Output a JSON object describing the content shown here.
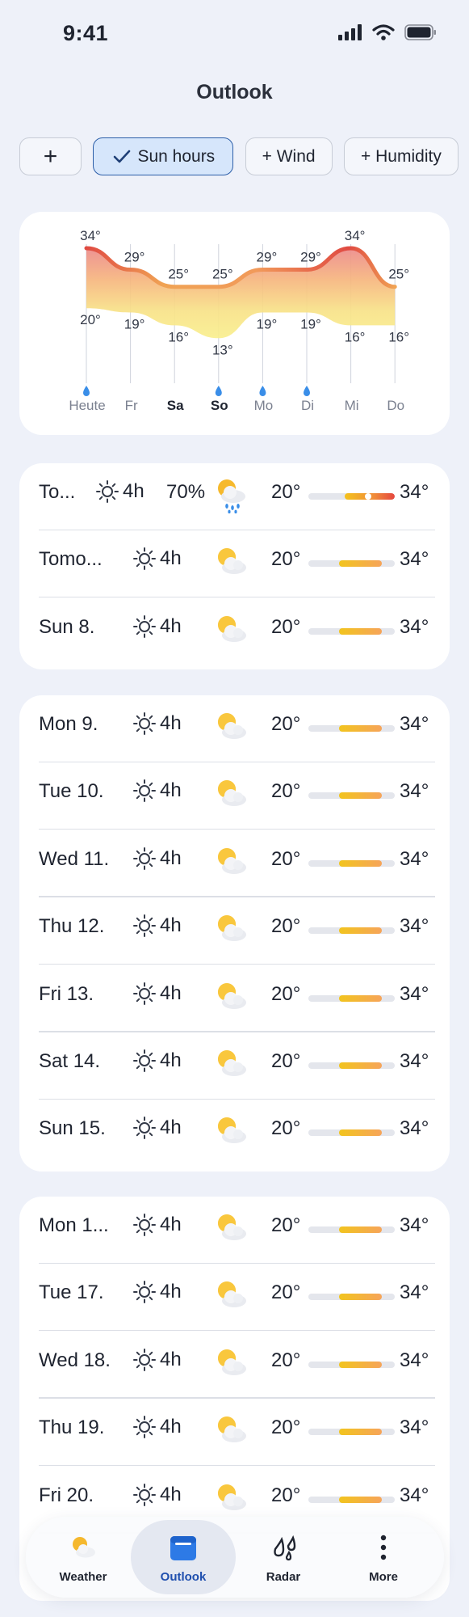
{
  "status_bar": {
    "time": "9:41"
  },
  "header": {
    "title": "Outlook"
  },
  "chips": [
    {
      "label": "+",
      "active": false
    },
    {
      "label": "Sun hours",
      "active": true
    },
    {
      "label": "+ Wind",
      "active": false
    },
    {
      "label": "+ Humidity",
      "active": false
    }
  ],
  "chart_data": {
    "type": "area",
    "categories": [
      "Heute",
      "Fr",
      "Sa",
      "So",
      "Mo",
      "Di",
      "Mi",
      "Do"
    ],
    "highlighted_categories": [
      "Sa",
      "So"
    ],
    "rain_days": [
      "Heute",
      "So",
      "Mo",
      "Di"
    ],
    "series": [
      {
        "name": "max",
        "values": [
          34,
          29,
          25,
          25,
          29,
          29,
          34,
          25
        ]
      },
      {
        "name": "min",
        "values": [
          20,
          19,
          16,
          13,
          19,
          19,
          16,
          16
        ]
      }
    ],
    "unit": "°",
    "colors": {
      "hot": "#e04a42",
      "warm": "#f0a354",
      "cool": "#f6e87a"
    }
  },
  "forecast_groups": [
    [
      {
        "day": "To...",
        "sun": "4h",
        "precip": "70%",
        "icon": "sun-cloud-rain",
        "min": "20°",
        "max": "34°",
        "current": true
      },
      {
        "day": "Tomo...",
        "sun": "4h",
        "icon": "partly-cloudy",
        "min": "20°",
        "max": "34°"
      },
      {
        "day": "Sun 8.",
        "sun": "4h",
        "icon": "partly-cloudy",
        "min": "20°",
        "max": "34°"
      }
    ],
    [
      {
        "day": "Mon 9.",
        "sun": "4h",
        "icon": "partly-cloudy",
        "min": "20°",
        "max": "34°"
      },
      {
        "day": "Tue 10.",
        "sun": "4h",
        "icon": "partly-cloudy",
        "min": "20°",
        "max": "34°"
      },
      {
        "day": "Wed 11.",
        "sun": "4h",
        "icon": "partly-cloudy",
        "min": "20°",
        "max": "34°"
      },
      {
        "day": "Thu 12.",
        "sun": "4h",
        "icon": "partly-cloudy",
        "min": "20°",
        "max": "34°"
      },
      {
        "day": "Fri 13.",
        "sun": "4h",
        "icon": "partly-cloudy",
        "min": "20°",
        "max": "34°"
      },
      {
        "day": "Sat 14.",
        "sun": "4h",
        "icon": "partly-cloudy",
        "min": "20°",
        "max": "34°"
      },
      {
        "day": "Sun 15.",
        "sun": "4h",
        "icon": "partly-cloudy",
        "min": "20°",
        "max": "34°"
      }
    ],
    [
      {
        "day": "Mon 1...",
        "sun": "4h",
        "icon": "partly-cloudy",
        "min": "20°",
        "max": "34°"
      },
      {
        "day": "Tue 17.",
        "sun": "4h",
        "icon": "partly-cloudy",
        "min": "20°",
        "max": "34°"
      },
      {
        "day": "Wed 18.",
        "sun": "4h",
        "icon": "partly-cloudy",
        "min": "20°",
        "max": "34°"
      },
      {
        "day": "Thu 19.",
        "sun": "4h",
        "icon": "partly-cloudy",
        "min": "20°",
        "max": "34°"
      },
      {
        "day": "Fri 20.",
        "sun": "4h",
        "icon": "partly-cloudy",
        "min": "20°",
        "max": "34°"
      }
    ]
  ],
  "tab_bar": [
    {
      "label": "Weather",
      "icon": "weather-icon",
      "active": false
    },
    {
      "label": "Outlook",
      "icon": "calendar-icon",
      "active": true
    },
    {
      "label": "Radar",
      "icon": "raindrops-icon",
      "active": false
    },
    {
      "label": "More",
      "icon": "more-icon",
      "active": false
    }
  ],
  "colors": {
    "accent": "#1f4fae",
    "chip_active_bg": "#d6e6fb",
    "background": "#eef1f9"
  }
}
